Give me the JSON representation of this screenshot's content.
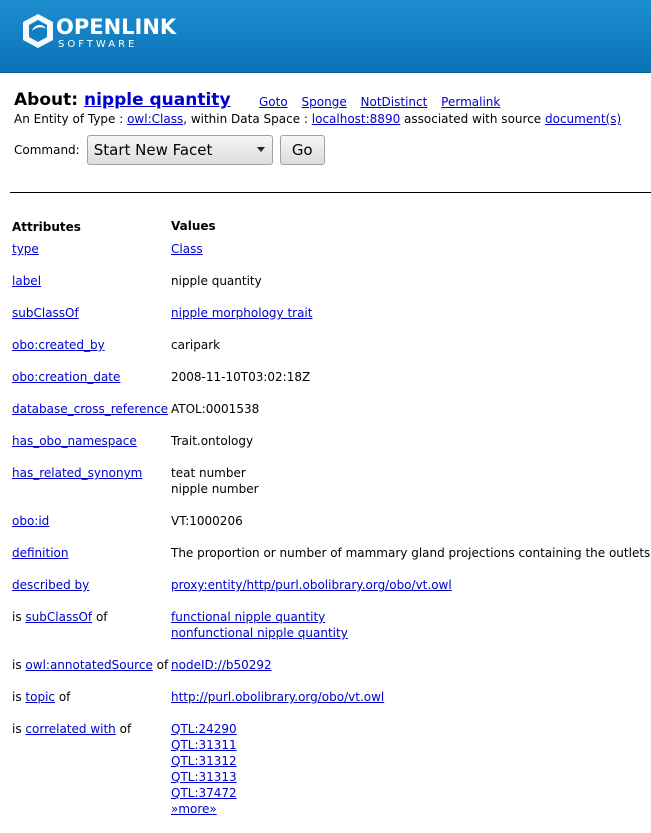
{
  "header": {
    "logo_word": "OPENLINK",
    "logo_sub": "SOFTWARE",
    "bg_color": "#0a73b7"
  },
  "about": {
    "prefix": "About:",
    "entity": "nipple quantity",
    "links": [
      "Goto",
      "Sponge",
      "NotDistinct",
      "Permalink"
    ]
  },
  "entity_line": {
    "text1": "An Entity of Type : ",
    "type_link": "owl:Class",
    "text2": ", within Data Space : ",
    "space_link": "localhost:8890",
    "text3": " associated with source ",
    "source_link": "document(s)"
  },
  "command": {
    "label": "Command:",
    "selected": "Start New Facet",
    "go": "Go"
  },
  "table": {
    "header_attr": "Attributes",
    "header_vals": "Values",
    "rows": [
      {
        "attr": "type",
        "values": [
          "Class"
        ],
        "value_links": true
      },
      {
        "attr": "label",
        "values": [
          "nipple quantity"
        ],
        "value_links": false
      },
      {
        "attr": "subClassOf",
        "values": [
          "nipple morphology trait"
        ],
        "value_links": true
      },
      {
        "attr": "obo:created_by",
        "values": [
          "caripark"
        ],
        "value_links": false
      },
      {
        "attr": "obo:creation_date",
        "values": [
          "2008-11-10T03:02:18Z"
        ],
        "value_links": false
      },
      {
        "attr": "database_cross_reference",
        "values": [
          "ATOL:0001538"
        ],
        "value_links": false
      },
      {
        "attr": "has_obo_namespace",
        "values": [
          "Trait.ontology"
        ],
        "value_links": false
      },
      {
        "attr": "has_related_synonym",
        "values": [
          "teat number",
          "nipple number"
        ],
        "value_links": false
      },
      {
        "attr": "obo:id",
        "values": [
          "VT:1000206"
        ],
        "value_links": false
      },
      {
        "attr": "definition",
        "values": [
          "The proportion or number of mammary gland projections containing the outlets of"
        ],
        "value_links": false
      },
      {
        "attr": "described by",
        "values": [
          "proxy:entity/http/purl.obolibrary.org/obo/vt.owl"
        ],
        "value_links": true
      },
      {
        "attr": "subClassOf",
        "inverse": true,
        "values": [
          "functional nipple quantity",
          "nonfunctional nipple quantity"
        ],
        "value_links": true
      },
      {
        "attr": "owl:annotatedSource",
        "inverse": true,
        "values": [
          "nodeID://b50292"
        ],
        "value_links": true
      },
      {
        "attr": "topic",
        "inverse": true,
        "values": [
          "http://purl.obolibrary.org/obo/vt.owl"
        ],
        "value_links": true
      },
      {
        "attr": "correlated with",
        "inverse": true,
        "values": [
          "QTL:24290",
          "QTL:31311",
          "QTL:31312",
          "QTL:31313",
          "QTL:37472",
          "»more»"
        ],
        "value_links": true
      }
    ],
    "inverse_prefix": "is ",
    "inverse_suffix": " of"
  }
}
